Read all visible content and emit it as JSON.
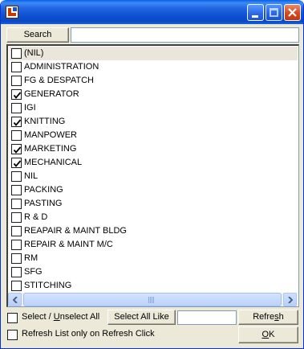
{
  "toolbar": {
    "search_label": "Search",
    "search_value": ""
  },
  "list": {
    "items": [
      {
        "label": "(NIL)",
        "checked": false,
        "selected": true
      },
      {
        "label": "ADMINISTRATION",
        "checked": false
      },
      {
        "label": "FG & DESPATCH",
        "checked": false
      },
      {
        "label": "GENERATOR",
        "checked": true
      },
      {
        "label": "IGI",
        "checked": false
      },
      {
        "label": "KNITTING",
        "checked": true
      },
      {
        "label": "MANPOWER",
        "checked": false
      },
      {
        "label": "MARKETING",
        "checked": true
      },
      {
        "label": "MECHANICAL",
        "checked": true
      },
      {
        "label": "NIL",
        "checked": false
      },
      {
        "label": "PACKING",
        "checked": false
      },
      {
        "label": "PASTING",
        "checked": false
      },
      {
        "label": "R & D",
        "checked": false
      },
      {
        "label": "REAPAIR & MAINT BLDG",
        "checked": false
      },
      {
        "label": "REPAIR & MAINT M/C",
        "checked": false
      },
      {
        "label": "RM",
        "checked": false
      },
      {
        "label": "SFG",
        "checked": false
      },
      {
        "label": "STITCHING",
        "checked": false
      }
    ]
  },
  "footer": {
    "select_unselect_prefix": "Select / ",
    "select_unselect_u": "U",
    "select_unselect_suffix": "nselect All",
    "select_unselect_checked": false,
    "select_all_like_label": "Select All Like",
    "like_value": "",
    "refresh_prefix": "Refre",
    "refresh_u": "s",
    "refresh_suffix": "h",
    "refresh_only_label": "Refresh List only on Refresh Click",
    "refresh_only_checked": false,
    "ok_u": "O",
    "ok_suffix": "K"
  },
  "colors": {
    "titlebar": "#0a4fd0",
    "selected_row": "#ebe6dc",
    "window_face": "#ece9d8"
  }
}
